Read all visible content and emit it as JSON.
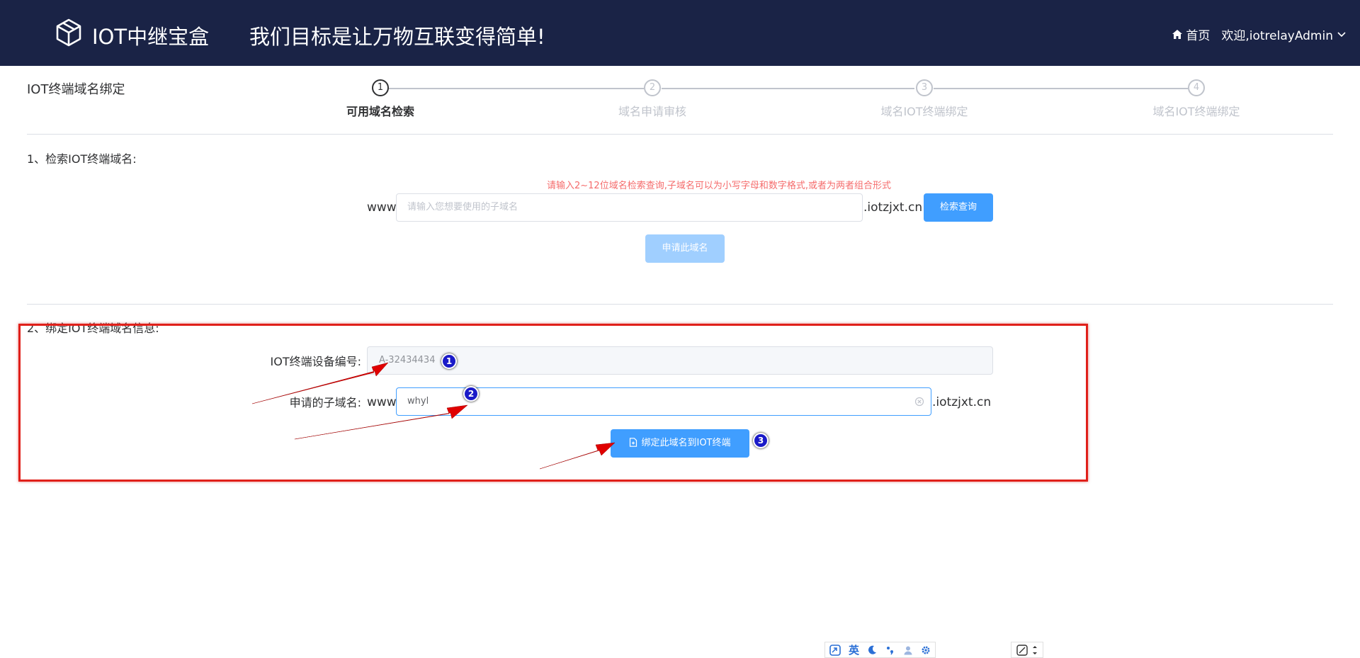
{
  "header": {
    "brand": "IOT中继宝盒",
    "slogan": "我们目标是让万物互联变得简单!",
    "home_label": "首页",
    "user_label": "欢迎,iotrelayAdmin"
  },
  "page_title": "IOT终端域名绑定",
  "steps": [
    {
      "number": "1",
      "label": "可用域名检索",
      "active": true
    },
    {
      "number": "2",
      "label": "域名申请审核",
      "active": false
    },
    {
      "number": "3",
      "label": "域名IOT终端绑定",
      "active": false
    },
    {
      "number": "4",
      "label": "域名IOT终端绑定",
      "active": false
    }
  ],
  "search_section": {
    "title": "1、检索IOT终端域名:",
    "hint": "请输入2~12位域名检索查询,子域名可以为小写字母和数字格式,或者为两者组合形式",
    "prefix": "www.",
    "placeholder": "请输入您想要使用的子域名",
    "suffix": ".iotzjxt.cn",
    "search_button": "检索查询",
    "apply_button": "申请此域名"
  },
  "bind_section": {
    "title": "2、绑定IOT终端域名信息:",
    "device_label": "IOT终端设备编号:",
    "device_value": "A-32434434",
    "subdomain_label": "申请的子域名:",
    "prefix": "www.",
    "subdomain_value": "whyl",
    "suffix": ".iotzjxt.cn",
    "bind_button": "绑定此域名到IOT终端"
  },
  "annotations": [
    "1",
    "2",
    "3"
  ],
  "ime": {
    "lang": "英"
  },
  "colors": {
    "header_bg": "#1a2346",
    "primary": "#409eff",
    "hint": "#f56c6c",
    "highlight": "#e0201a"
  }
}
